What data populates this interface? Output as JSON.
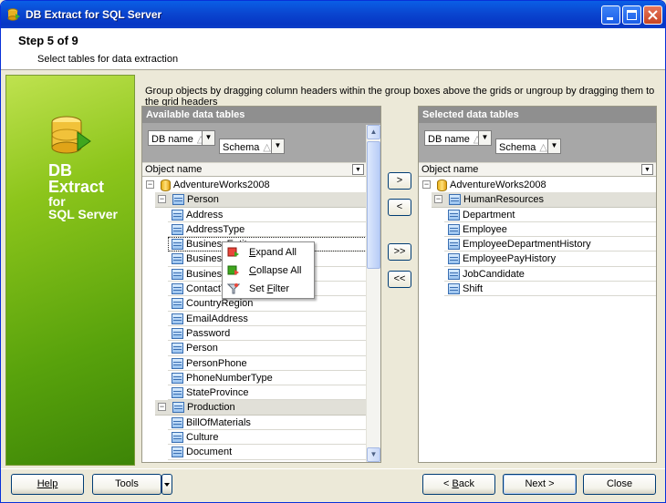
{
  "window": {
    "title": "DB Extract for SQL Server"
  },
  "header": {
    "step": "Step 5 of 9",
    "subtitle": "Select tables for data extraction"
  },
  "sidebar": {
    "brand_line1": "DB",
    "brand_line2": "Extract",
    "brand_line3": "for",
    "brand_line4": "SQL Server"
  },
  "instruction": "Group objects by dragging column headers within the group boxes above the grids or ungroup by dragging them to the grid headers",
  "available": {
    "title": "Available data tables",
    "group_db": "DB name",
    "group_schema": "Schema",
    "column": "Object name",
    "database": "AdventureWorks2008",
    "groups": [
      {
        "name": "Person",
        "tables": [
          "Address",
          "AddressType",
          "BusinessEntity",
          "BusinessEntityAddress",
          "BusinessEntityContact",
          "ContactType",
          "CountryRegion",
          "EmailAddress",
          "Password",
          "Person",
          "PersonPhone",
          "PhoneNumberType",
          "StateProvince"
        ]
      },
      {
        "name": "Production",
        "tables": [
          "BillOfMaterials",
          "Culture",
          "Document"
        ]
      }
    ]
  },
  "selected": {
    "title": "Selected data tables",
    "group_db": "DB name",
    "group_schema": "Schema",
    "column": "Object name",
    "database": "AdventureWorks2008",
    "groups": [
      {
        "name": "HumanResources",
        "tables": [
          "Department",
          "Employee",
          "EmployeeDepartmentHistory",
          "EmployeePayHistory",
          "JobCandidate",
          "Shift"
        ]
      }
    ]
  },
  "move_buttons": {
    "add": ">",
    "remove": "<",
    "add_all": ">>",
    "remove_all": "<<"
  },
  "context_menu": {
    "expand_prefix": "E",
    "expand_rest": "xpand All",
    "collapse_prefix": "C",
    "collapse_rest": "ollapse All",
    "filter_prefix": "Set ",
    "filter_u": "F",
    "filter_rest": "ilter"
  },
  "buttons": {
    "help": "Help",
    "tools": "Tools",
    "back_u": "B",
    "back_rest": "ack",
    "back_prefix": "< ",
    "next": "Next >",
    "close": "Close"
  }
}
